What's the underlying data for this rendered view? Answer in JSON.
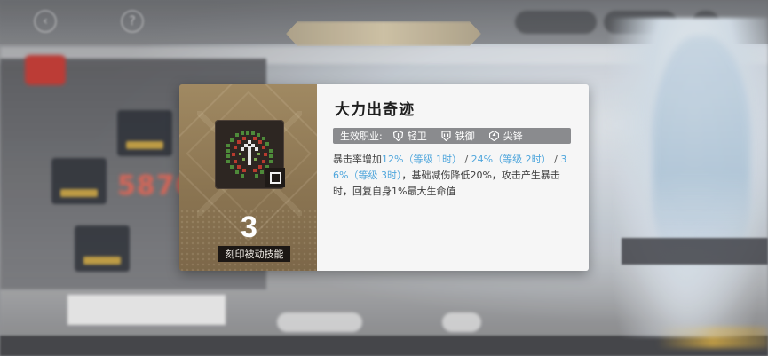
{
  "skill": {
    "name": "大力出奇迹",
    "level": "3",
    "type_label": "刻印被动技能",
    "icon": "crosshair-skill-icon"
  },
  "classes": {
    "label": "生效职业:",
    "items": [
      {
        "name": "轻卫",
        "icon": "light-guard-icon"
      },
      {
        "name": "铁御",
        "icon": "iron-guard-icon"
      },
      {
        "name": "尖锋",
        "icon": "spear-icon"
      }
    ]
  },
  "description": {
    "prefix": "暴击率增加",
    "tier1": "12%（等级 1时）",
    "sep1": " / ",
    "tier2": "24%（等级 2时）",
    "sep2": " / ",
    "tier3": "36%（等级 3时）",
    "suffix": "，基础减伤降低20%，攻击产生暴击时，回复自身1%最大生命值"
  },
  "colors": {
    "highlight": "#4fa6dc",
    "card_left": "#8b7552",
    "class_bar": "#8a8b8e"
  }
}
